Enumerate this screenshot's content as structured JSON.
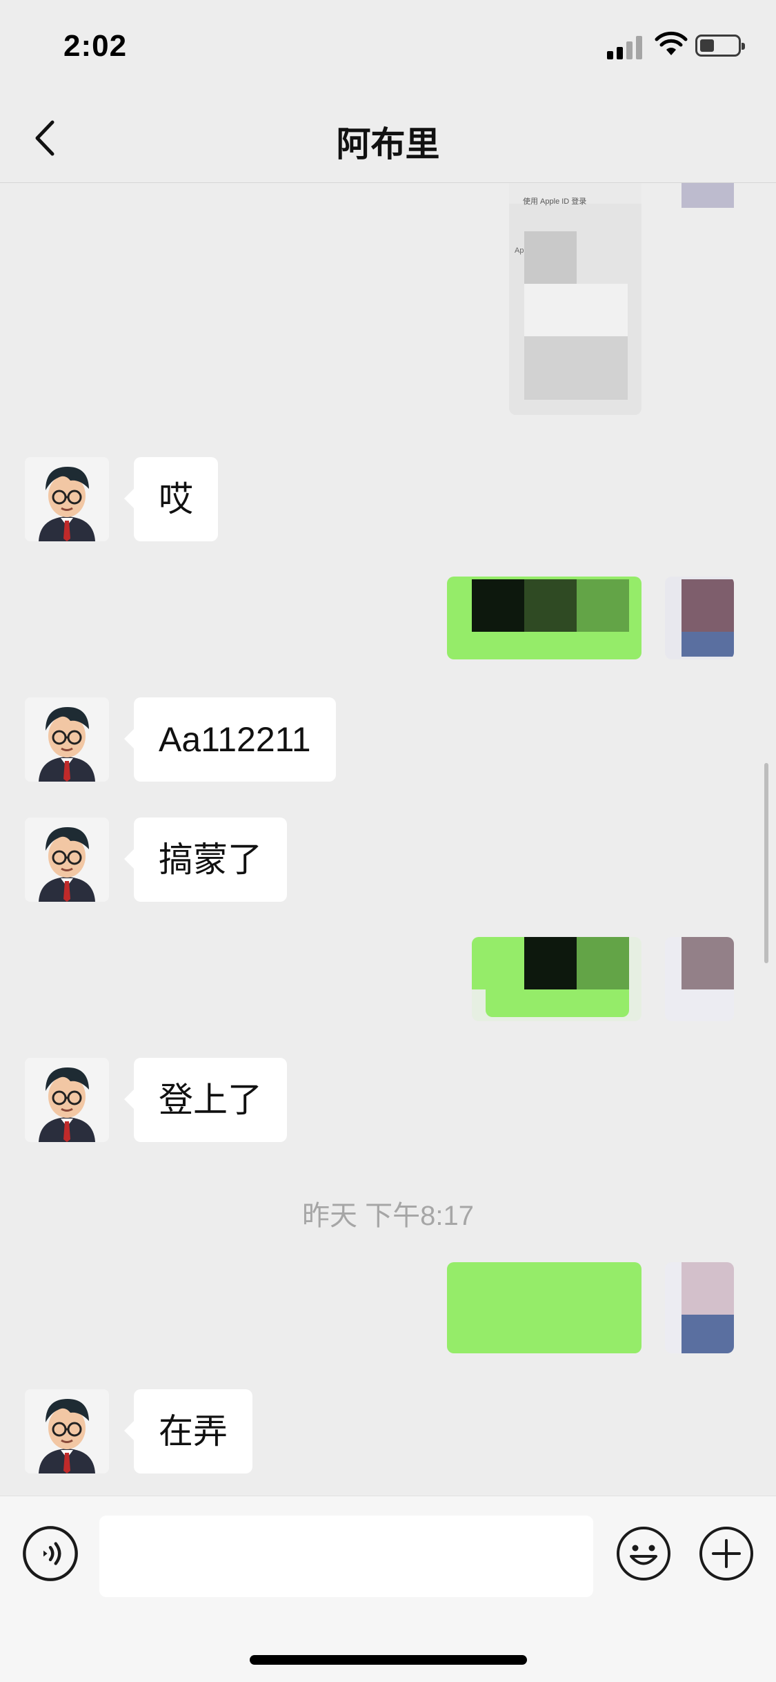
{
  "status_bar": {
    "time": "2:02",
    "signal_bars_filled": 2,
    "signal_bars_total": 4,
    "battery_level": 0.3
  },
  "header": {
    "title": "阿布里"
  },
  "screenshot_snippets": {
    "line1": "使用 Apple ID 登录",
    "line2": "Apple ID"
  },
  "messages": [
    {
      "kind": "incoming",
      "text": "哎"
    },
    {
      "kind": "incoming",
      "text": "Aa112211"
    },
    {
      "kind": "incoming",
      "text": "搞蒙了"
    },
    {
      "kind": "incoming",
      "text": "登上了"
    },
    {
      "kind": "incoming",
      "text": "在弄"
    }
  ],
  "timestamp": "昨天 下午8:17",
  "input": {
    "value": "",
    "placeholder": ""
  },
  "colors": {
    "chat_bg": "#ededed",
    "bubble_in": "#ffffff",
    "bubble_out": "#95ec69",
    "timestamp": "#a6a6a6"
  },
  "icons": {
    "back": "chevron-left-icon",
    "voice": "voice-icon",
    "emoji": "emoji-icon",
    "plus": "plus-icon"
  }
}
